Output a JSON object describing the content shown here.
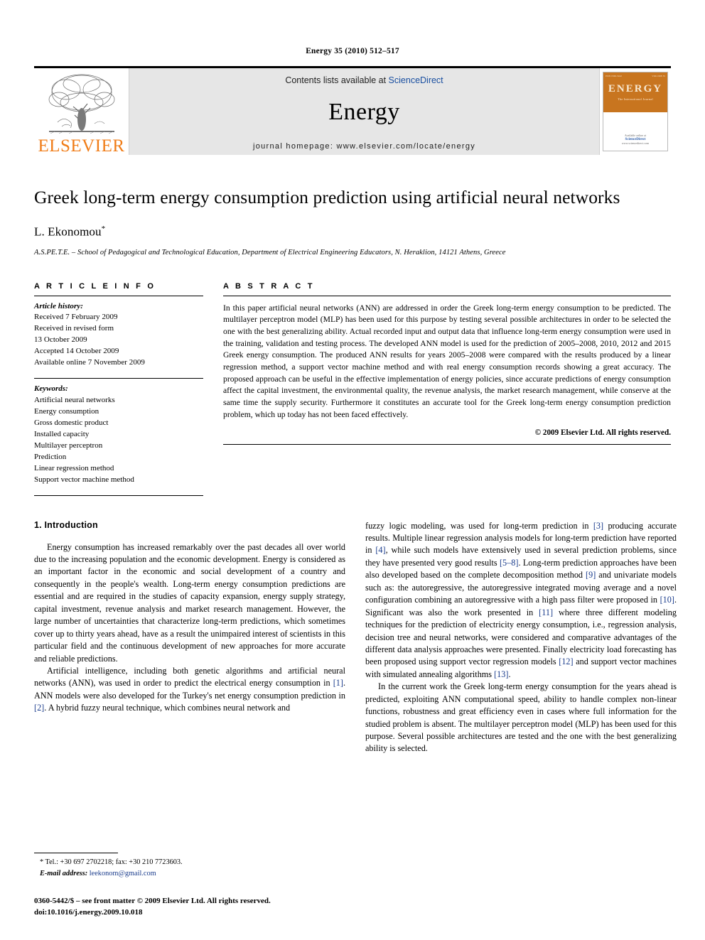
{
  "running_head": "Energy 35 (2010) 512–517",
  "masthead": {
    "publisher_name": "ELSEVIER",
    "contents_prefix": "Contents lists available at ",
    "contents_link": "ScienceDirect",
    "journal_title": "Energy",
    "homepage": "journal homepage: www.elsevier.com/locate/energy",
    "cover": {
      "title": "ENERGY",
      "subtitle": "The International Journal",
      "tiny_left": "ISSN 0360-5442",
      "tiny_right": "VOLUME 35",
      "footer_line1": "Available online at",
      "footer_line2": "ScienceDirect",
      "footer_line3": "www.sciencedirect.com"
    }
  },
  "article": {
    "title": "Greek long-term energy consumption prediction using artificial neural networks",
    "author": "L. Ekonomou",
    "author_marker": "*",
    "affiliation": "A.S.PE.T.E. – School of Pedagogical and Technological Education, Department of Electrical Engineering Educators, N. Heraklion, 14121 Athens, Greece"
  },
  "article_info": {
    "heading": "A R T I C L E  I N F O",
    "history_label": "Article history:",
    "history": [
      "Received 7 February 2009",
      "Received in revised form",
      "13 October 2009",
      "Accepted 14 October 2009",
      "Available online 7 November 2009"
    ],
    "keywords_label": "Keywords:",
    "keywords": [
      "Artificial neural networks",
      "Energy consumption",
      "Gross domestic product",
      "Installed capacity",
      "Multilayer perceptron",
      "Prediction",
      "Linear regression method",
      "Support vector machine method"
    ]
  },
  "abstract": {
    "heading": "A B S T R A C T",
    "text": "In this paper artificial neural networks (ANN) are addressed in order the Greek long-term energy consumption to be predicted. The multilayer perceptron model (MLP) has been used for this purpose by testing several possible architectures in order to be selected the one with the best generalizing ability. Actual recorded input and output data that influence long-term energy consumption were used in the training, validation and testing process. The developed ANN model is used for the prediction of 2005–2008, 2010, 2012 and 2015 Greek energy consumption. The produced ANN results for years 2005–2008 were compared with the results produced by a linear regression method, a support vector machine method and with real energy consumption records showing a great accuracy. The proposed approach can be useful in the effective implementation of energy policies, since accurate predictions of energy consumption affect the capital investment, the environmental quality, the revenue analysis, the market research management, while conserve at the same time the supply security. Furthermore it constitutes an accurate tool for the Greek long-term energy consumption prediction problem, which up today has not been faced effectively.",
    "copyright": "© 2009 Elsevier Ltd. All rights reserved."
  },
  "introduction": {
    "section_title": "1. Introduction",
    "left_paragraphs": [
      "Energy consumption has increased remarkably over the past decades all over world due to the increasing population and the economic development. Energy is considered as an important factor in the economic and social development of a country and consequently in the people's wealth. Long-term energy consumption predictions are essential and are required in the studies of capacity expansion, energy supply strategy, capital investment, revenue analysis and market research management. However, the large number of uncertainties that characterize long-term predictions, which sometimes cover up to thirty years ahead, have as a result the unimpaired interest of scientists in this particular field and the continuous development of new approaches for more accurate and reliable predictions.",
      "Artificial intelligence, including both genetic algorithms and artificial neural networks (ANN), was used in order to predict the electrical energy consumption in [1]. ANN models were also developed for the Turkey's net energy consumption prediction in [2]. A hybrid fuzzy neural technique, which combines neural network and"
    ],
    "right_paragraphs": [
      "fuzzy logic modeling, was used for long-term prediction in [3] producing accurate results. Multiple linear regression analysis models for long-term prediction have reported in [4], while such models have extensively used in several prediction problems, since they have presented very good results [5–8]. Long-term prediction approaches have been also developed based on the complete decomposition method [9] and univariate models such as: the autoregressive, the autoregressive integrated moving average and a novel configuration combining an autoregressive with a high pass filter were proposed in [10]. Significant was also the work presented in [11] where three different modeling techniques for the prediction of electricity energy consumption, i.e., regression analysis, decision tree and neural networks, were considered and comparative advantages of the different data analysis approaches were presented. Finally electricity load forecasting has been proposed using support vector regression models [12] and support vector machines with simulated annealing algorithms [13].",
      "In the current work the Greek long-term energy consumption for the years ahead is predicted, exploiting ANN computational speed, ability to handle complex non-linear functions, robustness and great efficiency even in cases where full information for the studied problem is absent. The multilayer perceptron model (MLP) has been used for this purpose. Several possible architectures are tested and the one with the best generalizing ability is selected."
    ]
  },
  "footnotes": {
    "corresponding": "* Tel.: +30 697 2702218; fax: +30 210 7723603.",
    "email_label": "E-mail address:",
    "email": "leekonom@gmail.com",
    "imprint_line1": "0360-5442/$ – see front matter © 2009 Elsevier Ltd. All rights reserved.",
    "imprint_line2": "doi:10.1016/j.energy.2009.10.018"
  },
  "colors": {
    "elsevier_orange": "#f07c17",
    "link_blue": "#1a4fa0",
    "reference_blue": "#1a3c8c",
    "masthead_gray": "#e6e6e6",
    "cover_orange": "#c8751f"
  }
}
